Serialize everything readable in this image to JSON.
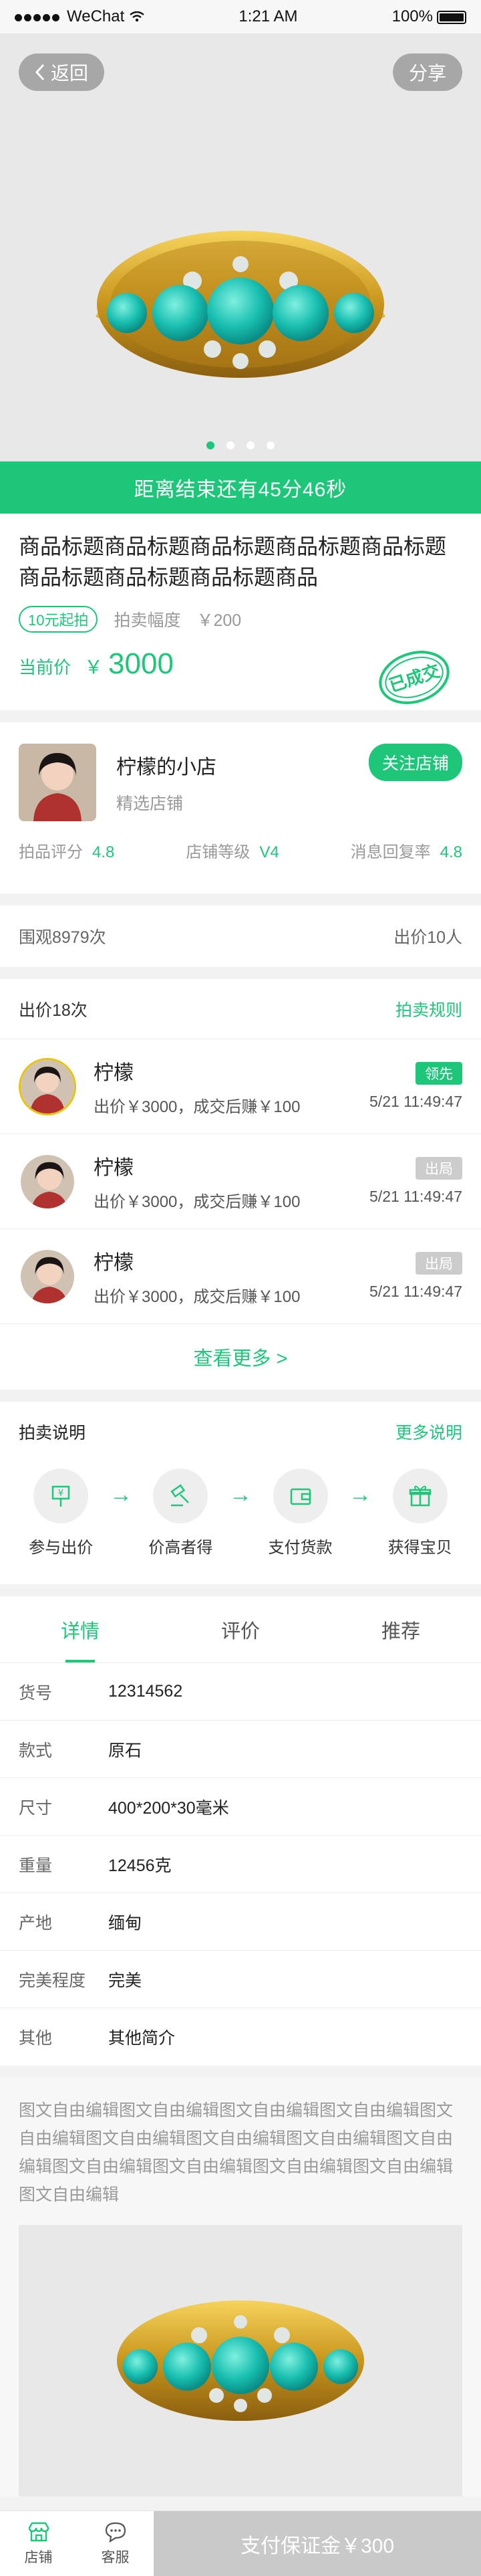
{
  "status": {
    "carrier": "WeChat",
    "time": "1:21 AM",
    "battery": "100%"
  },
  "hero": {
    "back": "返回",
    "share": "分享",
    "active_slide": 1,
    "slides": 4
  },
  "countdown": "距离结束还有45分46秒",
  "product": {
    "title": "商品标题商品标题商品标题商品标题商品标题商品标题商品标题商品标题商品",
    "start_tag": "10元起拍",
    "increment_label": "拍卖幅度",
    "increment_value": "￥200",
    "price_label": "当前价",
    "price_currency": "￥",
    "price_value": "3000",
    "stamp": "已成交"
  },
  "shop": {
    "name": "柠檬的小店",
    "subtitle": "精选店铺",
    "follow": "关注店铺",
    "stats": [
      {
        "label": "拍品评分",
        "value": "4.8"
      },
      {
        "label": "店铺等级",
        "value": "V4"
      },
      {
        "label": "消息回复率",
        "value": "4.8"
      }
    ]
  },
  "views": {
    "left": "围观8979次",
    "right": "出价10人"
  },
  "bids": {
    "title": "出价18次",
    "rules_link": "拍卖规则",
    "items": [
      {
        "name": "柠檬",
        "desc": "出价￥3000，成交后赚￥100",
        "badge": "领先",
        "time": "5/21 11:49:47"
      },
      {
        "name": "柠檬",
        "desc": "出价￥3000，成交后赚￥100",
        "badge": "出局",
        "time": "5/21 11:49:47"
      },
      {
        "name": "柠檬",
        "desc": "出价￥3000，成交后赚￥100",
        "badge": "出局",
        "time": "5/21 11:49:47"
      }
    ],
    "more": "查看更多 >"
  },
  "rules": {
    "title": "拍卖说明",
    "more_link": "更多说明",
    "steps": [
      "参与出价",
      "价高者得",
      "支付货款",
      "获得宝贝"
    ]
  },
  "tabs": [
    "详情",
    "评价",
    "推荐"
  ],
  "specs": [
    {
      "k": "货号",
      "v": "12314562"
    },
    {
      "k": "款式",
      "v": "原石"
    },
    {
      "k": "尺寸",
      "v": "400*200*30毫米"
    },
    {
      "k": "重量",
      "v": "12456克"
    },
    {
      "k": "产地",
      "v": "缅甸"
    },
    {
      "k": "完美程度",
      "v": "完美"
    },
    {
      "k": "其他",
      "v": "其他简介"
    }
  ],
  "description": "图文自由编辑图文自由编辑图文自由编辑图文自由编辑图文自由编辑图文自由编辑图文自由编辑图文自由编辑图文自由编辑图文自由编辑图文自由编辑图文自由编辑图文自由编辑图文自由编辑",
  "tabbar": {
    "shop": "店铺",
    "service": "客服",
    "pay": "支付保证金￥300"
  },
  "colors": {
    "accent": "#1ec67a",
    "lead_ring": "#e8c40f"
  }
}
